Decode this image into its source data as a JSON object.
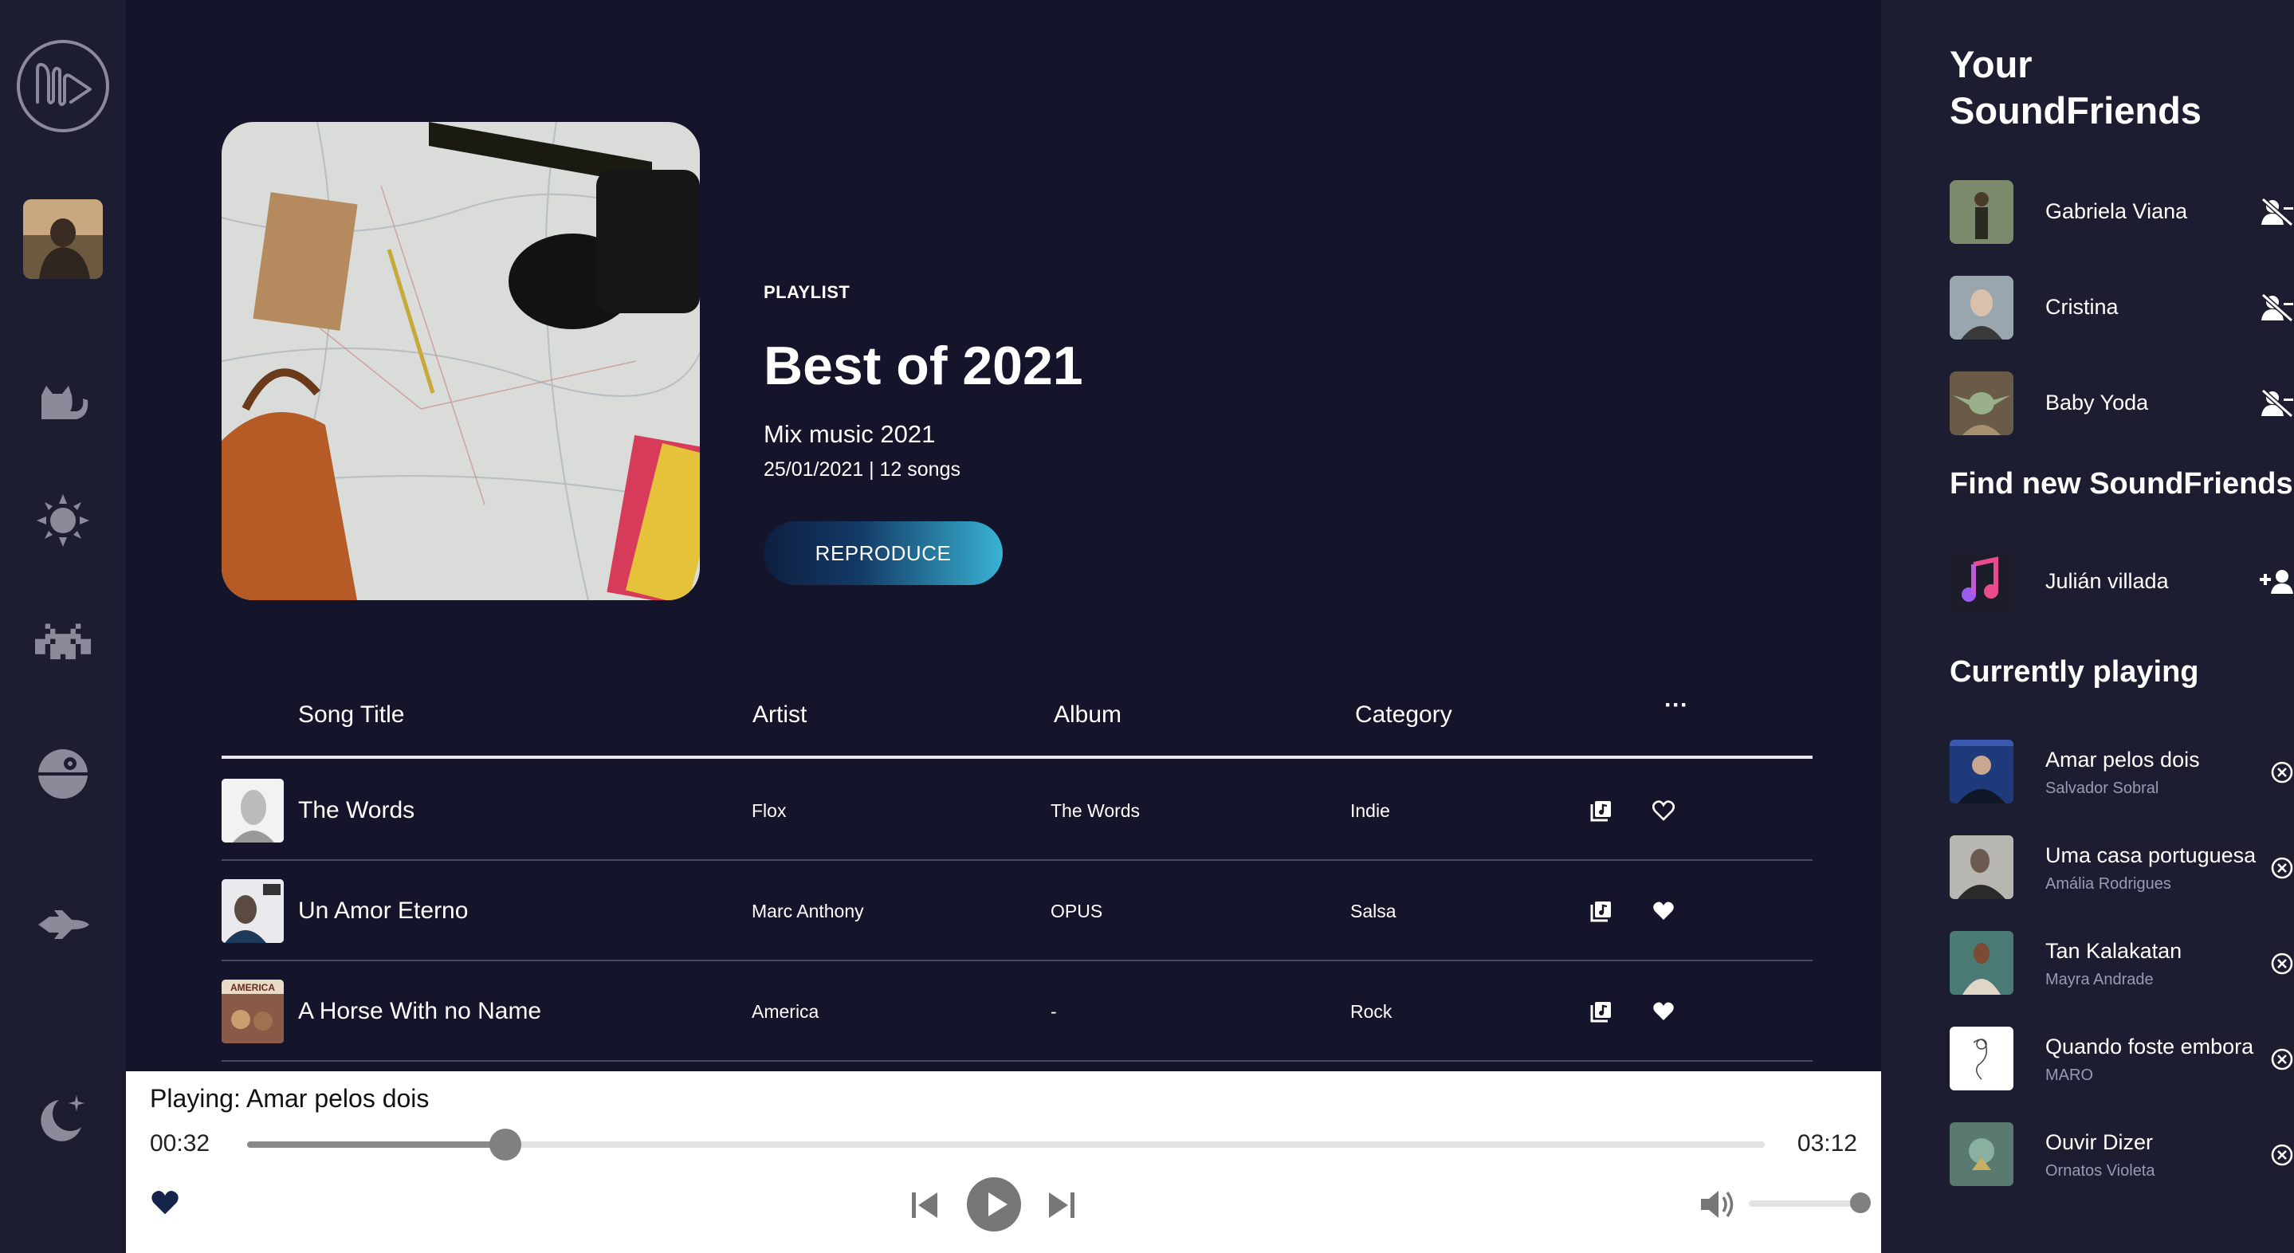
{
  "colors": {
    "main_bg": "#14142a",
    "panel_bg": "#1d1d31",
    "accent_start": "#0e1e40",
    "accent_end": "#39b3d4",
    "player_bg": "#ffffff"
  },
  "rail": {
    "items": [
      {
        "name": "logo-icon"
      },
      {
        "name": "user-avatar"
      },
      {
        "name": "cat-icon"
      },
      {
        "name": "sun-icon"
      },
      {
        "name": "space-invader-icon"
      },
      {
        "name": "death-star-icon"
      },
      {
        "name": "spaceship-icon"
      },
      {
        "name": "moon-stars-icon"
      }
    ]
  },
  "playlist": {
    "label": "PLAYLIST",
    "title": "Best of 2021",
    "subtitle": "Mix music 2021",
    "meta": "25/01/2021 | 12 songs",
    "button": "REPRODUCE"
  },
  "table": {
    "headers": {
      "title": "Song Title",
      "artist": "Artist",
      "album": "Album",
      "category": "Category",
      "more": "···"
    },
    "rows": [
      {
        "title": "The Words",
        "artist": "Flox",
        "album": "The Words",
        "category": "Indie",
        "liked": false
      },
      {
        "title": "Un Amor Eterno",
        "artist": "Marc Anthony",
        "album": "OPUS",
        "category": "Salsa",
        "liked": true
      },
      {
        "title": "A Horse With no Name",
        "artist": "America",
        "album": "-",
        "category": "Rock",
        "liked": true
      }
    ]
  },
  "player": {
    "now_playing": "Playing: Amar pelos dois",
    "current_time": "00:32",
    "total_time": "03:12",
    "progress": 0.17,
    "volume": 1.0,
    "liked": true
  },
  "sidebar": {
    "friends_title": "Your SoundFriends",
    "friends": [
      {
        "name": "Gabriela Viana",
        "action_icon": "remove-friend-icon"
      },
      {
        "name": "Cristina",
        "action_icon": "remove-friend-icon"
      },
      {
        "name": "Baby Yoda",
        "action_icon": "remove-friend-icon"
      }
    ],
    "find_title": "Find new SoundFriends",
    "suggestions": [
      {
        "name": "Julián villada",
        "action_icon": "add-friend-icon"
      }
    ],
    "playing_title": "Currently playing",
    "queue": [
      {
        "title": "Amar pelos dois",
        "artist": "Salvador Sobral"
      },
      {
        "title": "Uma casa portuguesa",
        "artist": "Amália Rodrigues"
      },
      {
        "title": "Tan Kalakatan",
        "artist": "Mayra Andrade"
      },
      {
        "title": "Quando foste embora",
        "artist": "MARO"
      },
      {
        "title": "Ouvir Dizer",
        "artist": "Ornatos Violeta"
      }
    ]
  }
}
